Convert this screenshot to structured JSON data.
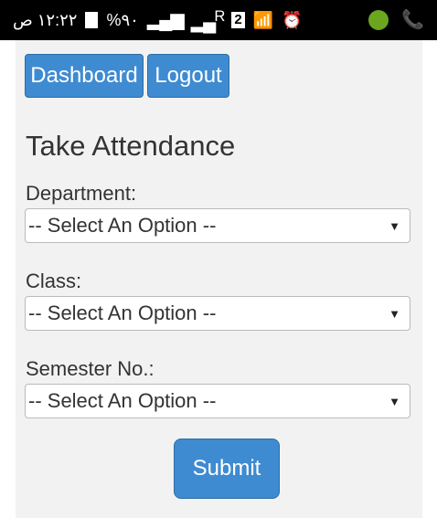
{
  "status_bar": {
    "time": "١٢:٢٢ ص",
    "battery_percent": "%٩٠",
    "sim_badge": "2",
    "network_badge": "R"
  },
  "nav": {
    "dashboard_label": "Dashboard",
    "logout_label": "Logout"
  },
  "page": {
    "title": "Take Attendance"
  },
  "form": {
    "department_label": "Department:",
    "department_value": "-- Select An Option --",
    "class_label": "Class:",
    "class_value": "-- Select An Option --",
    "semester_label": "Semester No.:",
    "semester_value": "-- Select An Option --",
    "submit_label": "Submit"
  },
  "colors": {
    "button_bg": "#3e8bd1",
    "content_bg": "#f2f2f2"
  }
}
